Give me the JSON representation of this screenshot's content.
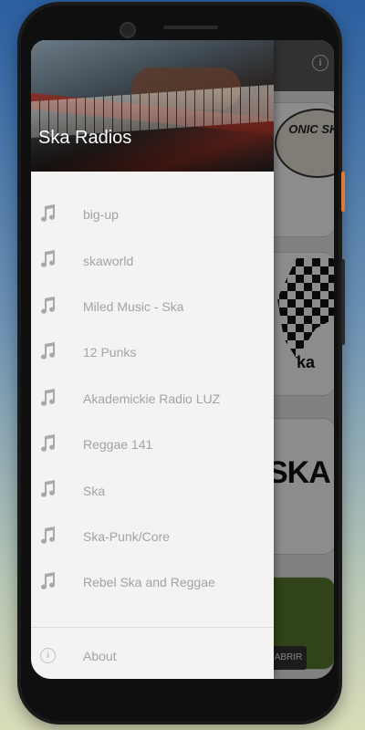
{
  "drawer": {
    "title": "Ska Radios",
    "items": [
      {
        "label": "big-up",
        "icon": "music-note-icon"
      },
      {
        "label": "skaworld",
        "icon": "music-note-icon"
      },
      {
        "label": "Miled Music - Ska",
        "icon": "music-note-icon"
      },
      {
        "label": "12 Punks",
        "icon": "music-note-icon"
      },
      {
        "label": "Akademickie Radio LUZ",
        "icon": "music-note-icon"
      },
      {
        "label": "Reggae 141",
        "icon": "music-note-icon"
      },
      {
        "label": "Ska",
        "icon": "music-note-icon"
      },
      {
        "label": "Ska-Punk/Core",
        "icon": "music-note-icon"
      },
      {
        "label": "Rebel Ska and Reggae",
        "icon": "music-note-icon"
      }
    ],
    "about_label": "About"
  },
  "background": {
    "card1_logo": "ONIC SKA",
    "card2_text": "ka",
    "card3_text": "SKA",
    "open_button": "ABRIR"
  },
  "colors": {
    "drawer_bg": "#f5f3f1",
    "item_text": "#a3a3a3",
    "icon": "#a8a8a8"
  }
}
